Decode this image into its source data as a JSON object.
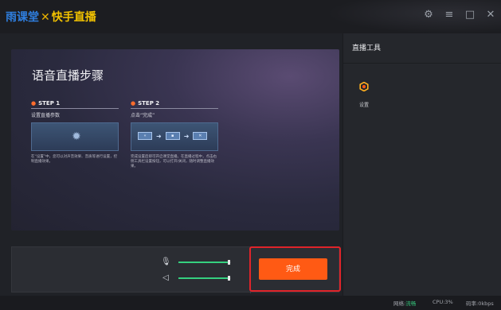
{
  "titlebar": {
    "brand_left": "雨课堂",
    "brand_cross": "✕",
    "brand_right": "快手直播",
    "controls": [
      "gear-icon",
      "menu-icon",
      "maximize-icon",
      "close-icon"
    ],
    "control_glyphs": [
      "⚙",
      "≡",
      "□",
      "✕"
    ]
  },
  "guide": {
    "title": "语音直播步骤",
    "steps": [
      {
        "label": "STEP 1",
        "subtitle": "设置直播参数",
        "desc": "在“设置”中，您可以对声音效果、音质等进行设置，控制直播效果。"
      },
      {
        "label": "STEP 2",
        "subtitle": "点击“完成”",
        "desc": "完成设置后即可开启课堂直播。在直播过程中，点击右侧工具栏设置按钮，可以打开/关闭，随时调整直播效果。"
      }
    ]
  },
  "controls": {
    "mic_level": 0.97,
    "speaker_level": 0.97,
    "done_label": "完成"
  },
  "tools": {
    "header": "直播工具",
    "items": [
      {
        "label": "设置",
        "icon": "settings-icon"
      }
    ]
  },
  "status": {
    "network_label": "网络:",
    "network_value": "流畅",
    "cpu": "CPU:3%",
    "bitrate": "码率:0kbps"
  },
  "colors": {
    "accent": "#ff5a14",
    "highlight_outline": "#e0242a",
    "slider_fill": "#35d07f",
    "network_ok": "#36c27a"
  }
}
